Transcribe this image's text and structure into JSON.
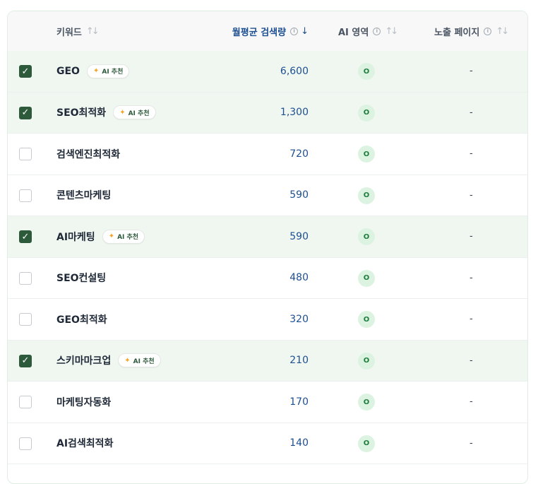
{
  "table": {
    "headers": {
      "keyword": "키워드",
      "volume": "월평균 검색량",
      "ai_area": "AI 영역",
      "exposure": "노출 페이지"
    },
    "badge_label": "AI 추천",
    "rows": [
      {
        "checked": true,
        "keyword": "GEO",
        "badge": true,
        "volume": "6,600",
        "ai": "O",
        "exposure": "-"
      },
      {
        "checked": true,
        "keyword": "SEO최적화",
        "badge": true,
        "volume": "1,300",
        "ai": "O",
        "exposure": "-"
      },
      {
        "checked": false,
        "keyword": "검색엔진최적화",
        "badge": false,
        "volume": "720",
        "ai": "O",
        "exposure": "-"
      },
      {
        "checked": false,
        "keyword": "콘텐츠마케팅",
        "badge": false,
        "volume": "590",
        "ai": "O",
        "exposure": "-"
      },
      {
        "checked": true,
        "keyword": "AI마케팅",
        "badge": true,
        "volume": "590",
        "ai": "O",
        "exposure": "-"
      },
      {
        "checked": false,
        "keyword": "SEO컨설팅",
        "badge": false,
        "volume": "480",
        "ai": "O",
        "exposure": "-"
      },
      {
        "checked": false,
        "keyword": "GEO최적화",
        "badge": false,
        "volume": "320",
        "ai": "O",
        "exposure": "-"
      },
      {
        "checked": true,
        "keyword": "스키마마크업",
        "badge": true,
        "volume": "210",
        "ai": "O",
        "exposure": "-"
      },
      {
        "checked": false,
        "keyword": "마케팅자동화",
        "badge": false,
        "volume": "170",
        "ai": "O",
        "exposure": "-"
      },
      {
        "checked": false,
        "keyword": "AI검색최적화",
        "badge": false,
        "volume": "140",
        "ai": "O",
        "exposure": "-"
      }
    ]
  },
  "colors": {
    "accent": "#2e5a3c",
    "volume_text": "#1d4f91",
    "selected_row": "#f0f7f1",
    "ai_dot_bg": "#ddf3e2"
  }
}
